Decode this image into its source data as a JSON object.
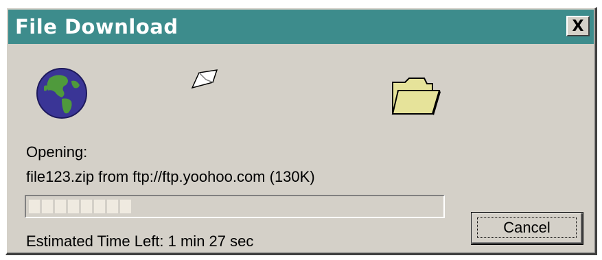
{
  "window": {
    "title": "File Download",
    "close_glyph": "X"
  },
  "icons": {
    "source": "globe-icon",
    "transfer": "flying-paper-icon",
    "destination": "folder-icon"
  },
  "status": {
    "opening_label": "Opening:",
    "file_line": "file123.zip from ftp://ftp.yoohoo.com (130K)",
    "time_left": "Estimated Time Left:  1 min 27 sec"
  },
  "progress": {
    "filled_blocks": 8,
    "fill_fraction": 0.28,
    "block_color": "#efeae0"
  },
  "buttons": {
    "cancel_label": "Cancel"
  },
  "colors": {
    "titlebar": "#3d8c8c",
    "face": "#d4d0c8",
    "folder": "#e6e39a",
    "globe_ocean": "#3a3596",
    "globe_land": "#4f9a3c"
  }
}
